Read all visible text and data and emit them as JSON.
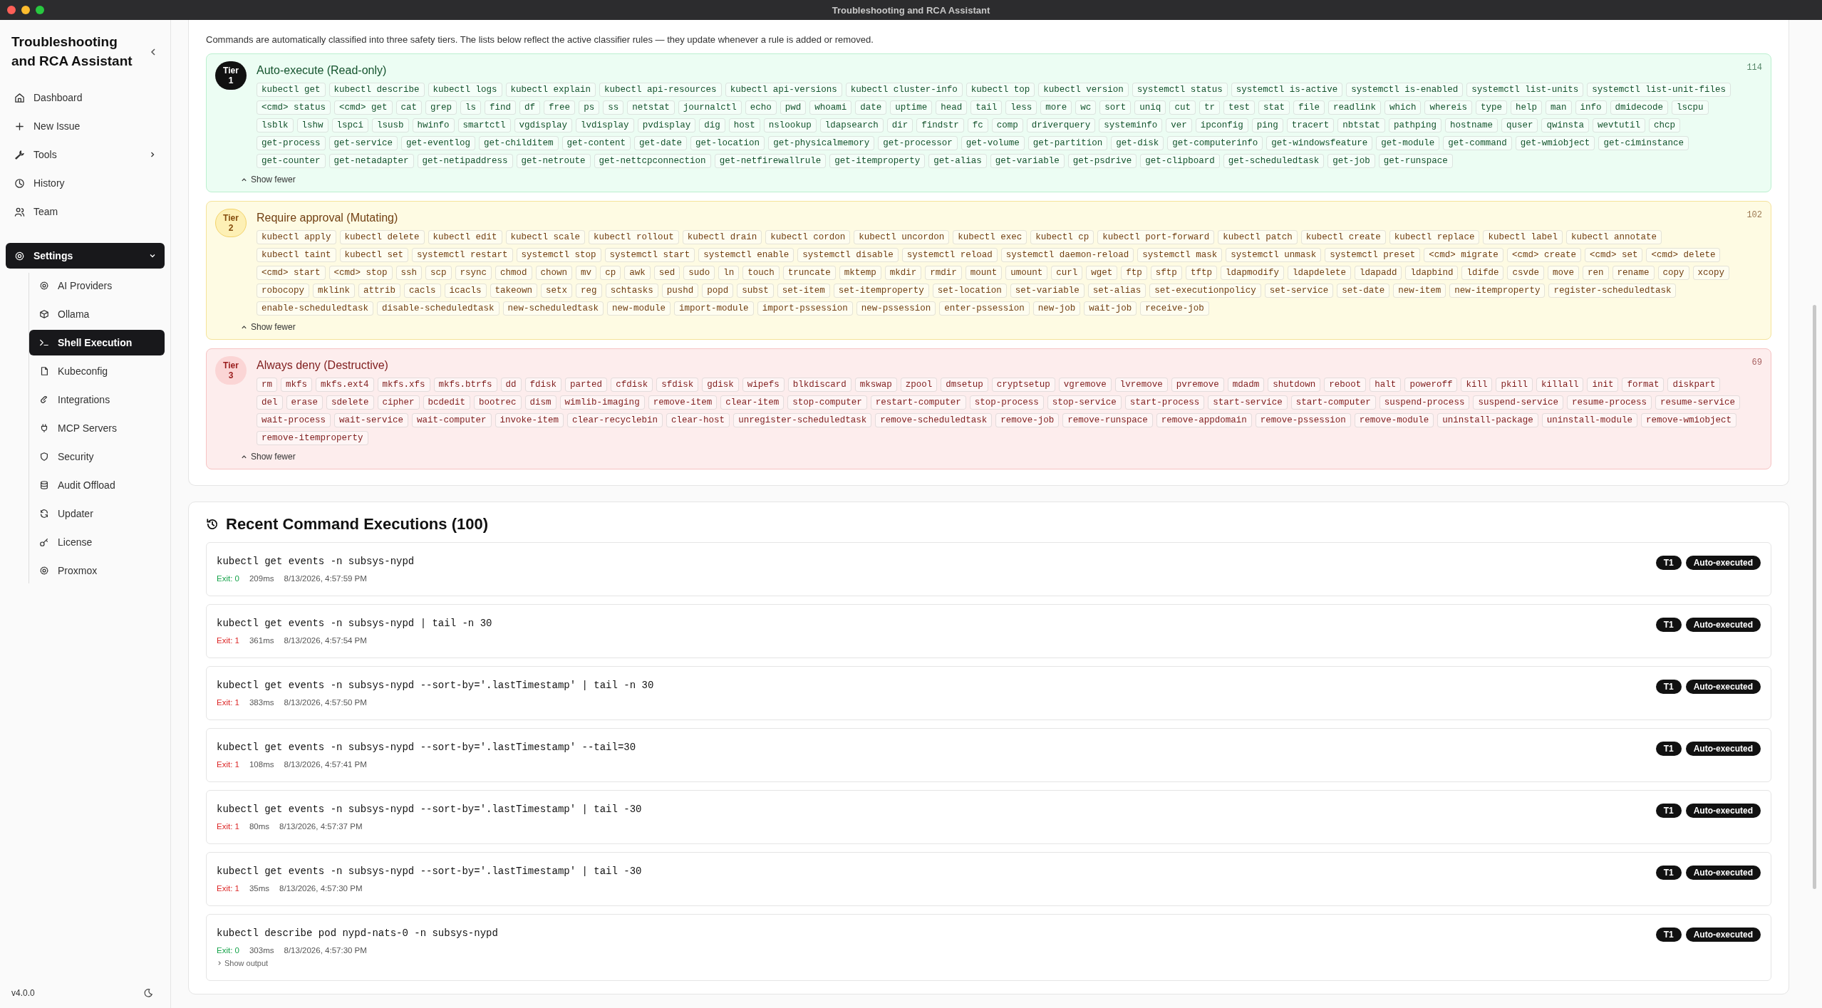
{
  "window": {
    "title": "Troubleshooting and RCA Assistant"
  },
  "sidebar": {
    "title": "Troubleshooting and RCA Assistant",
    "items": [
      {
        "label": "Dashboard",
        "selected": false
      },
      {
        "label": "New Issue",
        "selected": false
      },
      {
        "label": "Tools",
        "selected": false,
        "expanded": false
      },
      {
        "label": "History",
        "selected": false
      },
      {
        "label": "Team",
        "selected": false
      },
      {
        "label": "Settings",
        "selected": true,
        "expanded": true,
        "children": [
          {
            "label": "AI Providers",
            "selected": false
          },
          {
            "label": "Ollama",
            "selected": false
          },
          {
            "label": "Shell Execution",
            "selected": true
          },
          {
            "label": "Kubeconfig",
            "selected": false
          },
          {
            "label": "Integrations",
            "selected": false
          },
          {
            "label": "MCP Servers",
            "selected": false
          },
          {
            "label": "Security",
            "selected": false
          },
          {
            "label": "Audit Offload",
            "selected": false
          },
          {
            "label": "Updater",
            "selected": false
          },
          {
            "label": "License",
            "selected": false
          },
          {
            "label": "Proxmox",
            "selected": false
          }
        ]
      }
    ],
    "version": "v4.0.0"
  },
  "classifier": {
    "intro": "Commands are automatically classified into three safety tiers. The lists below reflect the active classifier rules — they update whenever a rule is added or removed.",
    "tiers": [
      {
        "kind": "read-only",
        "badge": "Tier 1",
        "title": "Auto-execute (Read-only)",
        "count": "114",
        "expanded": true,
        "toggle": "Show fewer",
        "commands": [
          "kubectl get",
          "kubectl describe",
          "kubectl logs",
          "kubectl explain",
          "kubectl api-resources",
          "kubectl api-versions",
          "kubectl cluster-info",
          "kubectl top",
          "kubectl version",
          "systemctl status",
          "systemctl is-active",
          "systemctl is-enabled",
          "systemctl list-units",
          "systemctl list-unit-files",
          "<cmd> status",
          "<cmd> get",
          "cat",
          "grep",
          "ls",
          "find",
          "df",
          "free",
          "ps",
          "ss",
          "netstat",
          "journalctl",
          "echo",
          "pwd",
          "whoami",
          "date",
          "uptime",
          "head",
          "tail",
          "less",
          "more",
          "wc",
          "sort",
          "uniq",
          "cut",
          "tr",
          "test",
          "stat",
          "file",
          "readlink",
          "which",
          "whereis",
          "type",
          "help",
          "man",
          "info",
          "dmidecode",
          "lscpu",
          "lsblk",
          "lshw",
          "lspci",
          "lsusb",
          "hwinfo",
          "smartctl",
          "vgdisplay",
          "lvdisplay",
          "pvdisplay",
          "dig",
          "host",
          "nslookup",
          "ldapsearch",
          "dir",
          "findstr",
          "fc",
          "comp",
          "driverquery",
          "systeminfo",
          "ver",
          "ipconfig",
          "ping",
          "tracert",
          "nbtstat",
          "pathping",
          "hostname",
          "quser",
          "qwinsta",
          "wevtutil",
          "chcp",
          "get-process",
          "get-service",
          "get-eventlog",
          "get-childitem",
          "get-content",
          "get-date",
          "get-location",
          "get-physicalmemory",
          "get-processor",
          "get-volume",
          "get-partition",
          "get-disk",
          "get-computerinfo",
          "get-windowsfeature",
          "get-module",
          "get-command",
          "get-wmiobject",
          "get-ciminstance",
          "get-counter",
          "get-netadapter",
          "get-netipaddress",
          "get-netroute",
          "get-nettcpconnection",
          "get-netfirewallrule",
          "get-itemproperty",
          "get-alias",
          "get-variable",
          "get-psdrive",
          "get-clipboard",
          "get-scheduledtask",
          "get-job",
          "get-runspace"
        ]
      },
      {
        "kind": "mutating",
        "badge": "Tier 2",
        "title": "Require approval (Mutating)",
        "count": "102",
        "expanded": true,
        "toggle": "Show fewer",
        "commands": [
          "kubectl apply",
          "kubectl delete",
          "kubectl edit",
          "kubectl scale",
          "kubectl rollout",
          "kubectl drain",
          "kubectl cordon",
          "kubectl uncordon",
          "kubectl exec",
          "kubectl cp",
          "kubectl port-forward",
          "kubectl patch",
          "kubectl create",
          "kubectl replace",
          "kubectl label",
          "kubectl annotate",
          "kubectl taint",
          "kubectl set",
          "systemctl restart",
          "systemctl stop",
          "systemctl start",
          "systemctl enable",
          "systemctl disable",
          "systemctl reload",
          "systemctl daemon-reload",
          "systemctl mask",
          "systemctl unmask",
          "systemctl preset",
          "<cmd> migrate",
          "<cmd> create",
          "<cmd> set",
          "<cmd> delete",
          "<cmd> start",
          "<cmd> stop",
          "ssh",
          "scp",
          "rsync",
          "chmod",
          "chown",
          "mv",
          "cp",
          "awk",
          "sed",
          "sudo",
          "ln",
          "touch",
          "truncate",
          "mktemp",
          "mkdir",
          "rmdir",
          "mount",
          "umount",
          "curl",
          "wget",
          "ftp",
          "sftp",
          "tftp",
          "ldapmodify",
          "ldapdelete",
          "ldapadd",
          "ldapbind",
          "ldifde",
          "csvde",
          "move",
          "ren",
          "rename",
          "copy",
          "xcopy",
          "robocopy",
          "mklink",
          "attrib",
          "cacls",
          "icacls",
          "takeown",
          "setx",
          "reg",
          "schtasks",
          "pushd",
          "popd",
          "subst",
          "set-item",
          "set-itemproperty",
          "set-location",
          "set-variable",
          "set-alias",
          "set-executionpolicy",
          "set-service",
          "set-date",
          "new-item",
          "new-itemproperty",
          "register-scheduledtask",
          "enable-scheduledtask",
          "disable-scheduledtask",
          "new-scheduledtask",
          "new-module",
          "import-module",
          "import-pssession",
          "new-pssession",
          "enter-pssession",
          "new-job",
          "wait-job",
          "receive-job"
        ]
      },
      {
        "kind": "destructive",
        "badge": "Tier 3",
        "title": "Always deny (Destructive)",
        "count": "69",
        "expanded": true,
        "toggle": "Show fewer",
        "commands": [
          "rm",
          "mkfs",
          "mkfs.ext4",
          "mkfs.xfs",
          "mkfs.btrfs",
          "dd",
          "fdisk",
          "parted",
          "cfdisk",
          "sfdisk",
          "gdisk",
          "wipefs",
          "blkdiscard",
          "mkswap",
          "zpool",
          "dmsetup",
          "cryptsetup",
          "vgremove",
          "lvremove",
          "pvremove",
          "mdadm",
          "shutdown",
          "reboot",
          "halt",
          "poweroff",
          "kill",
          "pkill",
          "killall",
          "init",
          "format",
          "diskpart",
          "del",
          "erase",
          "sdelete",
          "cipher",
          "bcdedit",
          "bootrec",
          "dism",
          "wimlib-imaging",
          "remove-item",
          "clear-item",
          "stop-computer",
          "restart-computer",
          "stop-process",
          "stop-service",
          "start-process",
          "start-service",
          "start-computer",
          "suspend-process",
          "suspend-service",
          "resume-process",
          "resume-service",
          "wait-process",
          "wait-service",
          "wait-computer",
          "invoke-item",
          "clear-recyclebin",
          "clear-host",
          "unregister-scheduledtask",
          "remove-scheduledtask",
          "remove-job",
          "remove-runspace",
          "remove-appdomain",
          "remove-pssession",
          "remove-module",
          "uninstall-package",
          "uninstall-module",
          "remove-wmiobject",
          "remove-itemproperty"
        ]
      }
    ]
  },
  "executions": {
    "title": "Recent Command Executions (100)",
    "items": [
      {
        "command": "kubectl get events -n subsys-nypd",
        "exit": "Exit: 0",
        "succeeded": true,
        "duration": "209ms",
        "time": "8/13/2026, 4:57:59 PM",
        "tier": "T1",
        "status": "Auto-executed"
      },
      {
        "command": "kubectl get events -n subsys-nypd | tail -n 30",
        "exit": "Exit: 1",
        "succeeded": false,
        "duration": "361ms",
        "time": "8/13/2026, 4:57:54 PM",
        "tier": "T1",
        "status": "Auto-executed"
      },
      {
        "command": "kubectl get events -n subsys-nypd --sort-by='.lastTimestamp' | tail -n 30",
        "exit": "Exit: 1",
        "succeeded": false,
        "duration": "383ms",
        "time": "8/13/2026, 4:57:50 PM",
        "tier": "T1",
        "status": "Auto-executed"
      },
      {
        "command": "kubectl get events -n subsys-nypd --sort-by='.lastTimestamp' --tail=30",
        "exit": "Exit: 1",
        "succeeded": false,
        "duration": "108ms",
        "time": "8/13/2026, 4:57:41 PM",
        "tier": "T1",
        "status": "Auto-executed"
      },
      {
        "command": "kubectl get events -n subsys-nypd --sort-by='.lastTimestamp' | tail -30",
        "exit": "Exit: 1",
        "succeeded": false,
        "duration": "80ms",
        "time": "8/13/2026, 4:57:37 PM",
        "tier": "T1",
        "status": "Auto-executed"
      },
      {
        "command": "kubectl get events -n subsys-nypd --sort-by='.lastTimestamp' | tail -30",
        "exit": "Exit: 1",
        "succeeded": false,
        "duration": "35ms",
        "time": "8/13/2026, 4:57:30 PM",
        "tier": "T1",
        "status": "Auto-executed"
      },
      {
        "command": "kubectl describe pod nypd-nats-0 -n subsys-nypd",
        "exit": "Exit: 0",
        "succeeded": true,
        "duration": "303ms",
        "time": "8/13/2026, 4:57:30 PM",
        "tier": "T1",
        "status": "Auto-executed",
        "output_toggle": "Show output"
      }
    ]
  }
}
